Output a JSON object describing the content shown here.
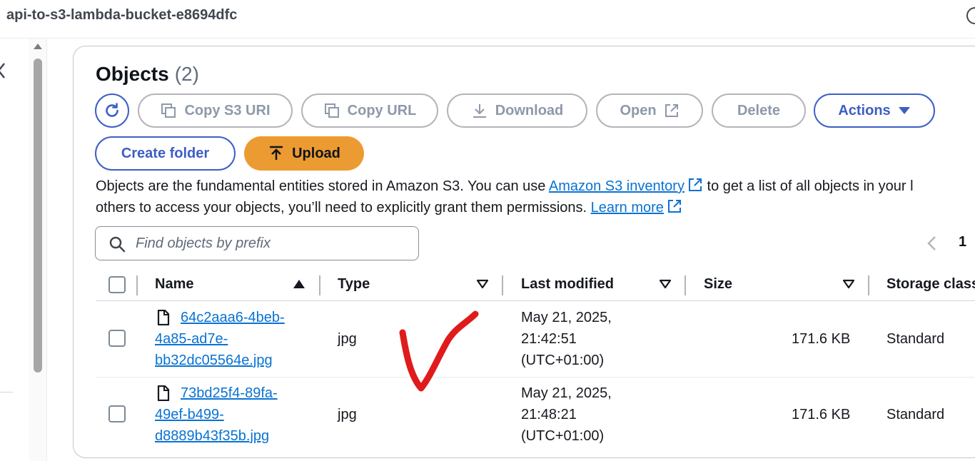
{
  "bucket": {
    "name": "api-to-s3-lambda-bucket-e8694dfc"
  },
  "objects": {
    "title": "Objects",
    "count": "(2)",
    "toolbar": {
      "refresh_icon": "refresh-icon",
      "copy_s3_uri": "Copy S3 URI",
      "copy_url": "Copy URL",
      "download": "Download",
      "open": "Open",
      "delete": "Delete",
      "actions": "Actions"
    },
    "create_folder": "Create folder",
    "upload": "Upload",
    "description": {
      "line1_prefix": "Objects are the fundamental entities stored in Amazon S3. You can use ",
      "inventory_link": "Amazon S3 inventory",
      "line1_suffix": " to get a list of all objects in your l",
      "line2_prefix": "others to access your objects, you’ll need to explicitly grant them permissions. ",
      "learn_more_link": "Learn more"
    },
    "search": {
      "placeholder": "Find objects by prefix",
      "value": ""
    },
    "pagination": {
      "current_page": "1"
    },
    "columns": [
      "Name",
      "Type",
      "Last modified",
      "Size",
      "Storage class"
    ],
    "rows": [
      {
        "name_lines": [
          "64c2aaa6-4beb-",
          "4a85-ad7e-",
          "bb32dc05564e.jpg"
        ],
        "type": "jpg",
        "last_modified_lines": [
          "May 21, 2025,",
          "21:42:51",
          "(UTC+01:00)"
        ],
        "size": "171.6 KB",
        "storage_class": "Standard"
      },
      {
        "name_lines": [
          "73bd25f4-89fa-",
          "49ef-b499-",
          "d8889b43f35b.jpg"
        ],
        "type": "jpg",
        "last_modified_lines": [
          "May 21, 2025,",
          "21:48:21",
          "(UTC+01:00)"
        ],
        "size": "171.6 KB",
        "storage_class": "Standard"
      }
    ]
  },
  "colors": {
    "link": "#0972d3",
    "upload_button": "#ec9b32",
    "annotation_check": "#e01b1b",
    "disabled": "#8d99a8"
  }
}
